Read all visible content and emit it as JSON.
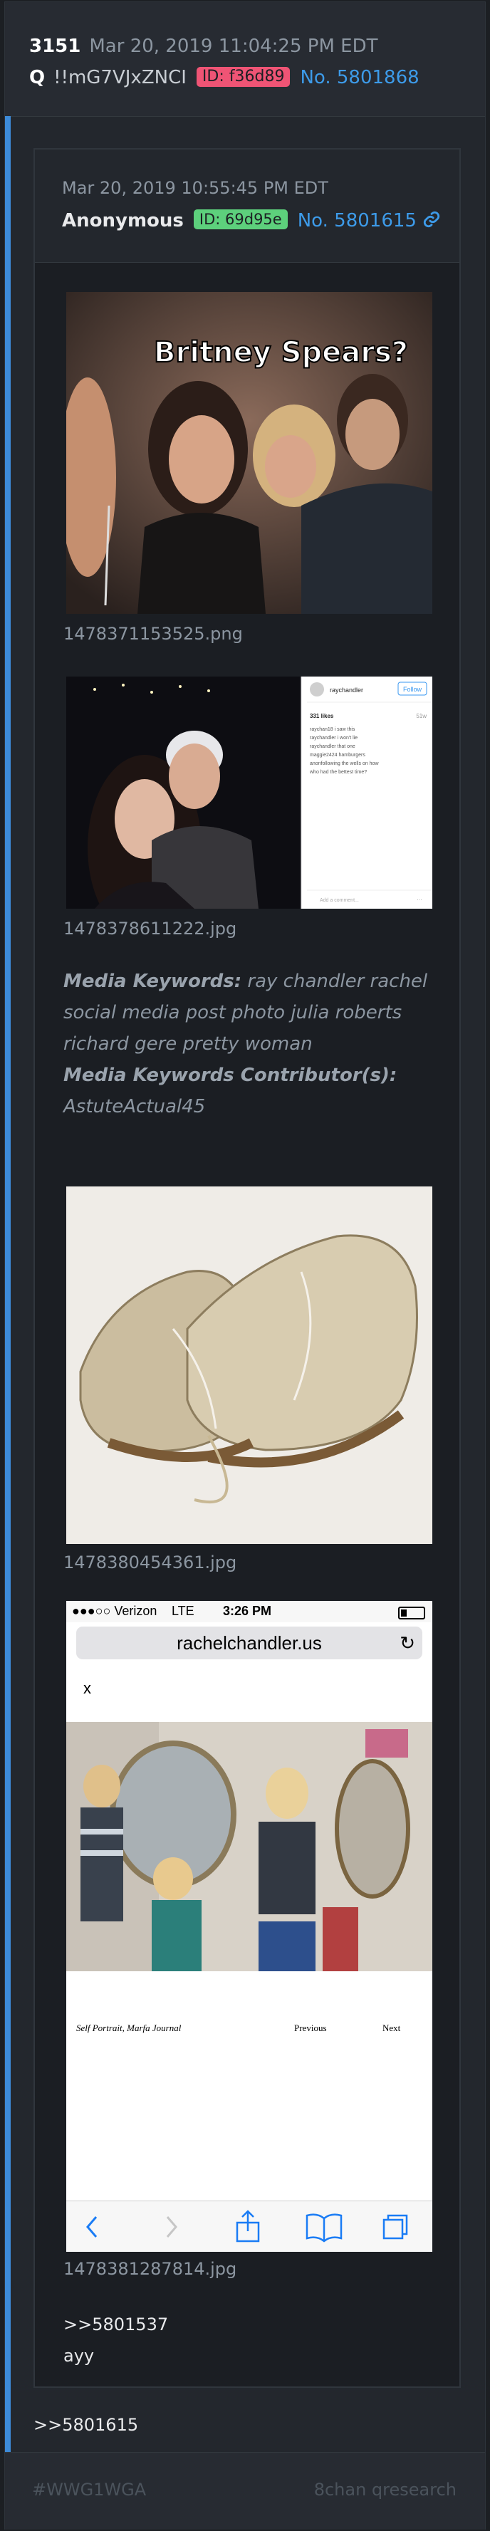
{
  "post": {
    "number": "3151",
    "date": "Mar 20, 2019 11:04:25 PM EDT",
    "q": "Q",
    "tripcode": "!!mG7VJxZNCI",
    "id": "ID: f36d89",
    "post_no": "No. 5801868"
  },
  "quoted": {
    "date": "Mar 20, 2019 10:55:45 PM EDT",
    "name": "Anonymous",
    "id": "ID: 69d95e",
    "post_no": "No. 5801615",
    "images": [
      {
        "caption_text": "Britney Spears?",
        "filename": "1478371153525.png"
      },
      {
        "filename": "1478378611222.jpg",
        "ig_user": "raychandler",
        "ig_follow": "Follow",
        "ig_likes": "331 likes",
        "ig_time": "51w",
        "ig_comments": [
          "raychan18 i saw this",
          "raychandler i won't lie",
          "raychandler that one",
          "maggie2424 hamburgers",
          "anonfollowing the wells on how",
          "who had the bettest time?"
        ],
        "ig_add": "Add a comment...",
        "ig_more": "···"
      },
      {
        "filename": "1478380454361.jpg"
      },
      {
        "filename": "1478381287814.jpg",
        "carrier": "●●●○○ Verizon",
        "network": "LTE",
        "time": "3:26 PM",
        "url": "rachelchandler.us",
        "close": "x",
        "photo_caption": "Self Portrait, Marfa Journal",
        "prev": "Previous",
        "next": "Next"
      }
    ],
    "keywords_label": "Media Keywords:",
    "keywords": "ray chandler rachel social media post photo julia roberts richard gere pretty woman",
    "contributors_label": "Media Keywords Contributor(s):",
    "contributors": "AstuteActual45",
    "reply_ref": ">>5801537",
    "reply_text": "ayy"
  },
  "post_reply_ref": ">>5801615",
  "footer": {
    "left": "#WWG1WGA",
    "right": "8chan qresearch"
  },
  "colors": {
    "accent": "#3d9be9",
    "id_red": "#ef5475",
    "id_green": "#5dd07c",
    "bar": "#3d8bd8"
  }
}
